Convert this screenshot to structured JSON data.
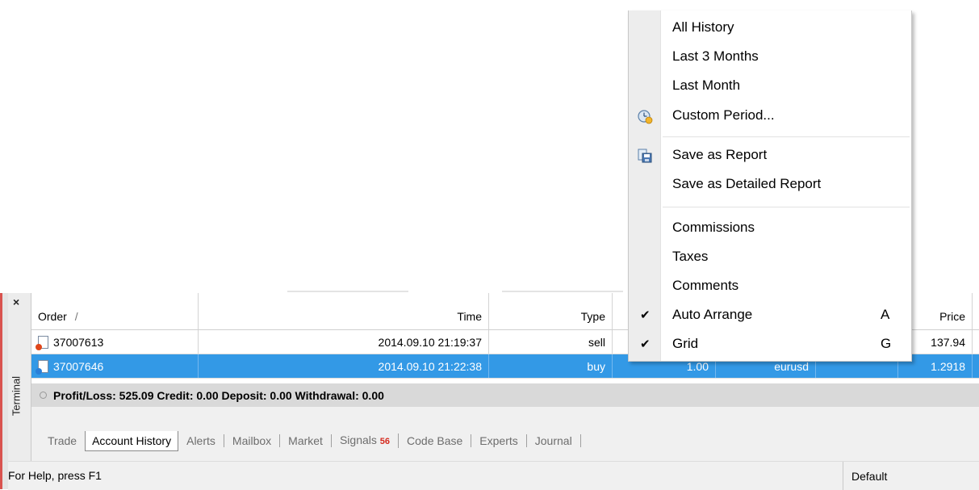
{
  "menu": {
    "items": [
      {
        "label": "All History"
      },
      {
        "label": "Last 3 Months"
      },
      {
        "label": "Last Month"
      },
      {
        "label": "Custom Period...",
        "icon": "clock-icon"
      },
      {
        "label": "Save as Report",
        "icon": "save-report-icon"
      },
      {
        "label": "Save as Detailed Report"
      },
      {
        "label": "Commissions"
      },
      {
        "label": "Taxes"
      },
      {
        "label": "Comments"
      },
      {
        "label": "Auto Arrange",
        "shortcut": "A",
        "checked": true
      },
      {
        "label": "Grid",
        "shortcut": "G",
        "checked": true
      }
    ],
    "checkmark": "✔"
  },
  "terminal": {
    "close_label": "×",
    "side_label": "Terminal",
    "columns": {
      "order": "Order",
      "sort_marker": "/",
      "time": "Time",
      "type": "Type",
      "price": "Price"
    },
    "rows": [
      {
        "order": "37007613",
        "time": "2014.09.10 21:19:37",
        "type": "sell",
        "volume": "",
        "symbol": "",
        "price": "137.94",
        "selected": false
      },
      {
        "order": "37007646",
        "time": "2014.09.10 21:22:38",
        "type": "buy",
        "volume": "1.00",
        "symbol": "eurusd",
        "price": "1.2918",
        "selected": true
      }
    ],
    "summary": "Profit/Loss: 525.09  Credit: 0.00  Deposit: 0.00  Withdrawal: 0.00",
    "tabs": [
      {
        "label": "Trade",
        "active": false
      },
      {
        "label": "Account History",
        "active": true
      },
      {
        "label": "Alerts",
        "active": false
      },
      {
        "label": "Mailbox",
        "active": false
      },
      {
        "label": "Market",
        "active": false
      },
      {
        "label": "Signals",
        "badge": "56",
        "active": false
      },
      {
        "label": "Code Base",
        "active": false
      },
      {
        "label": "Experts",
        "active": false
      },
      {
        "label": "Journal",
        "active": false
      }
    ]
  },
  "statusbar": {
    "help": "For Help, press F1",
    "profile": "Default"
  },
  "colors": {
    "selection": "#3399e6",
    "accent_strip": "#d9534f",
    "badge": "#d52a1e"
  }
}
